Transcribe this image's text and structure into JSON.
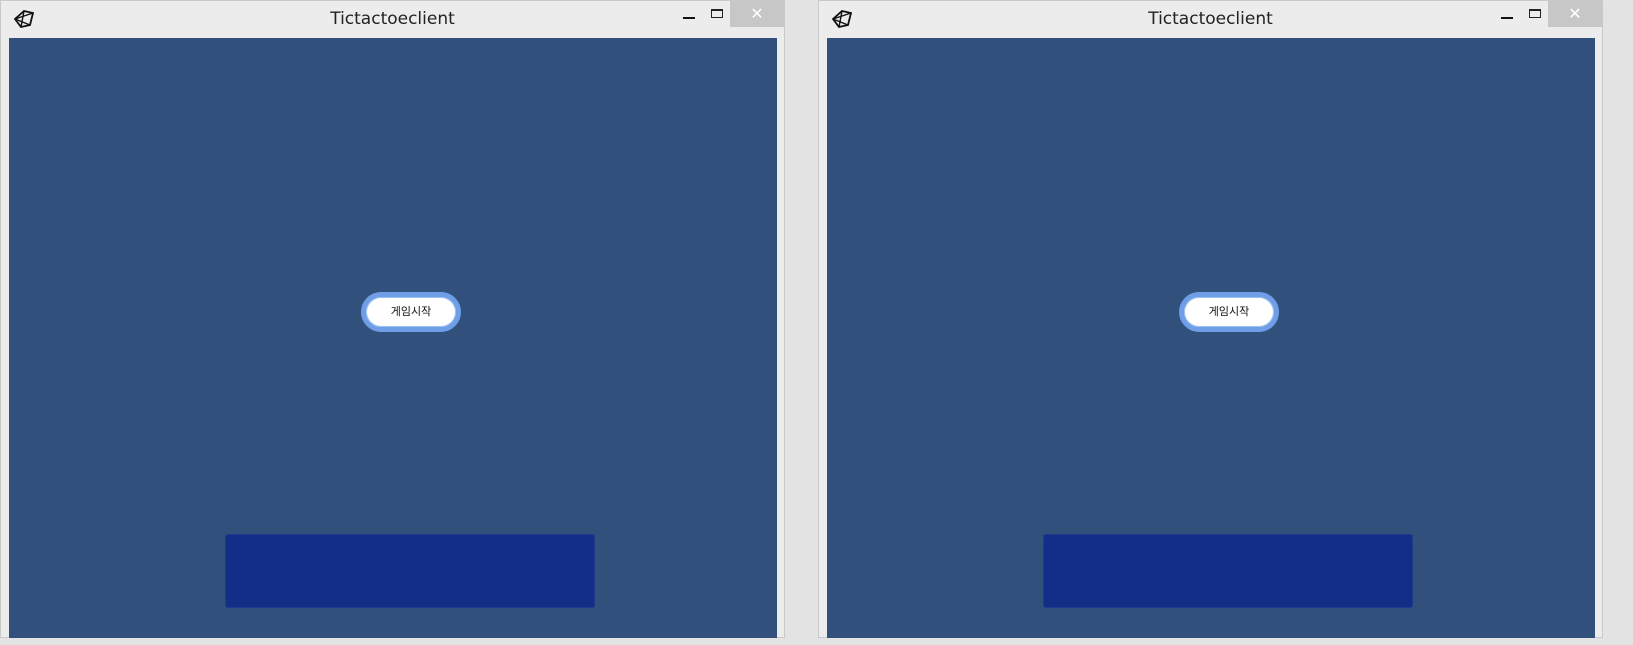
{
  "windows": [
    {
      "title": "Tictactoeclient",
      "close_glyph": "✕",
      "start_button_label": "게임시작",
      "background_color": "#31507c",
      "panel_color": "#122e86",
      "button_ring_color": "#6e9ee6"
    },
    {
      "title": "Tictactoeclient",
      "close_glyph": "✕",
      "start_button_label": "게임시작",
      "background_color": "#31507c",
      "panel_color": "#122e86",
      "button_ring_color": "#6e9ee6"
    }
  ],
  "icons": {
    "app": "unity-icon",
    "minimize": "minimize-icon",
    "maximize": "maximize-icon",
    "close": "close-icon"
  }
}
